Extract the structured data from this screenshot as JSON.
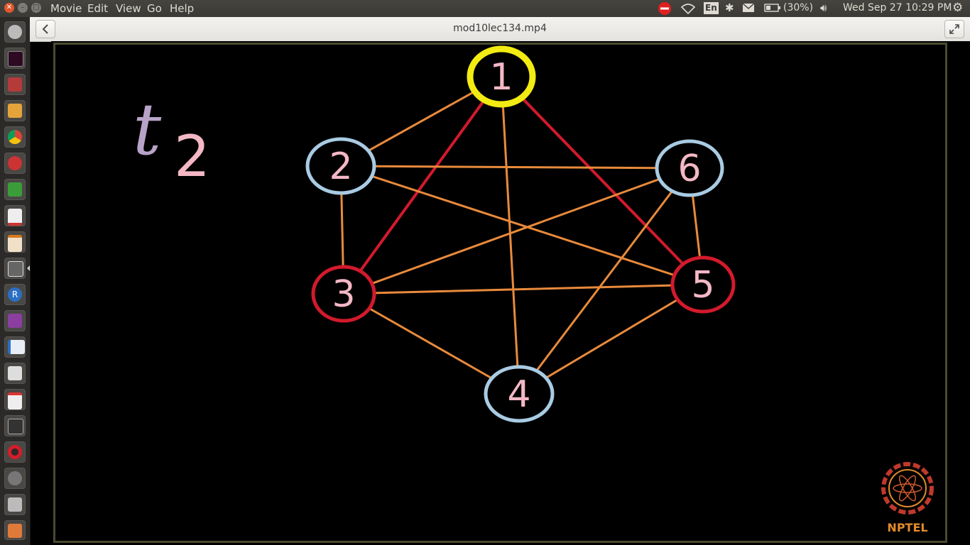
{
  "menubar": {
    "items": [
      "Movie",
      "Edit",
      "View",
      "Go",
      "Help"
    ],
    "keyboard": "En",
    "battery": "(30%)",
    "clock": "Wed Sep 27 10:29 PM"
  },
  "window": {
    "title": "mod10lec134.mp4"
  },
  "video": {
    "label_t": "t",
    "label_sub": "2",
    "logo_text": "NPTEL",
    "nodes": [
      {
        "id": "1",
        "color": "#f2ec13"
      },
      {
        "id": "2",
        "color": "#a9cbe3"
      },
      {
        "id": "3",
        "color": "#d21a2c"
      },
      {
        "id": "4",
        "color": "#a9cbe3"
      },
      {
        "id": "5",
        "color": "#d21a2c"
      },
      {
        "id": "6",
        "color": "#a9cbe3"
      }
    ],
    "edges": [
      {
        "from": "1",
        "to": "2",
        "color": "#e88a3c"
      },
      {
        "from": "1",
        "to": "3",
        "color": "#d21a2c"
      },
      {
        "from": "1",
        "to": "4",
        "color": "#e88a3c"
      },
      {
        "from": "1",
        "to": "5",
        "color": "#d21a2c"
      },
      {
        "from": "2",
        "to": "6",
        "color": "#e88a3c"
      },
      {
        "from": "2",
        "to": "3",
        "color": "#e88a3c"
      },
      {
        "from": "2",
        "to": "5",
        "color": "#e88a3c"
      },
      {
        "from": "3",
        "to": "6",
        "color": "#e88a3c"
      },
      {
        "from": "3",
        "to": "5",
        "color": "#e88a3c"
      },
      {
        "from": "3",
        "to": "4",
        "color": "#e88a3c"
      },
      {
        "from": "4",
        "to": "6",
        "color": "#e88a3c"
      },
      {
        "from": "4",
        "to": "5",
        "color": "#e88a3c"
      },
      {
        "from": "6",
        "to": "5",
        "color": "#e88a3c"
      }
    ]
  },
  "launcher_icons": [
    "dash-icon",
    "terminal-icon",
    "files-icon",
    "sublime-icon",
    "chrome-icon",
    "settings-icon",
    "spreadsheet-icon",
    "document-viewer-icon",
    "presentation-icon",
    "video-player-icon",
    "r-icon",
    "media-icon",
    "writer-icon",
    "text-editor-icon",
    "gmail-icon",
    "ipython-icon",
    "opera-icon",
    "gimp-icon",
    "scanner-icon",
    "image-icon",
    "more-icon"
  ]
}
